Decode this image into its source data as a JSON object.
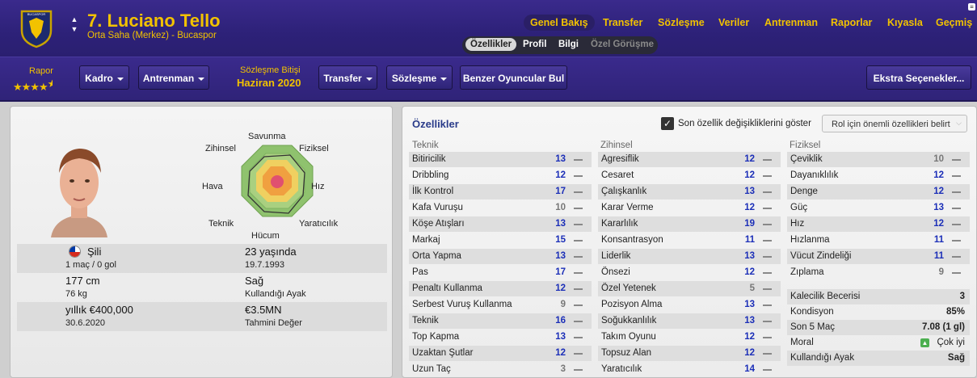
{
  "header": {
    "club_crest_text": "BUCASPOR",
    "player_title": "7. Luciano Tello",
    "player_role": "Orta Saha (Merkez) - Bucaspor",
    "nav": [
      {
        "label": "Genel Bakış",
        "active": true
      },
      {
        "label": "Transfer"
      },
      {
        "label": "Sözleşme"
      },
      {
        "label": "Veriler"
      },
      {
        "label": "Antrenman"
      },
      {
        "label": "Raporlar"
      },
      {
        "label": "Kıyasla"
      },
      {
        "label": "Geçmiş"
      }
    ],
    "subtabs": [
      {
        "label": "Özellikler",
        "selected": true
      },
      {
        "label": "Profil"
      },
      {
        "label": "Bilgi"
      },
      {
        "label": "Özel Görüşme",
        "disabled": true
      }
    ]
  },
  "toolbar": {
    "report_label": "Rapor",
    "report_stars": 4.5,
    "kadro": "Kadro",
    "antrenman": "Antrenman",
    "contract_end_label": "Sözleşme Bitişi",
    "contract_end_value": "Haziran 2020",
    "transfer": "Transfer",
    "sozlesme": "Sözleşme",
    "similar": "Benzer Oyuncular Bul",
    "extra": "Ekstra Seçenekler..."
  },
  "radar": {
    "labels": {
      "top": "Savunma",
      "top_right": "Fiziksel",
      "right": "Hız",
      "bottom_right": "Yaratıcılık",
      "bottom": "Hücum",
      "bottom_left": "Teknik",
      "left": "Hava",
      "top_left": "Zihinsel"
    }
  },
  "player_info": {
    "nation": "Şili",
    "caps": "1 maç / 0 gol",
    "age": "23 yaşında",
    "dob": "19.7.1993",
    "height": "177 cm",
    "weight": "76 kg",
    "foot": "Sağ",
    "foot_label": "Kullandığı Ayak",
    "wage": "yıllık €400,000",
    "wage_until": "30.6.2020",
    "value": "€3.5MN",
    "value_label": "Tahmini Değer"
  },
  "attributes": {
    "title": "Özellikler",
    "show_changes_label": "Son özellik değişikliklerini göster",
    "show_changes_checked": true,
    "role_button": "Rol için önemli özellikleri belirt",
    "technical_header": "Teknik",
    "technical": [
      {
        "name": "Bitiricilik",
        "value": "13",
        "color": "blue"
      },
      {
        "name": "Dribbling",
        "value": "12",
        "color": "blue"
      },
      {
        "name": "İlk Kontrol",
        "value": "17",
        "color": "blue"
      },
      {
        "name": "Kafa Vuruşu",
        "value": "10",
        "color": "gray"
      },
      {
        "name": "Köşe Atışları",
        "value": "13",
        "color": "blue"
      },
      {
        "name": "Markaj",
        "value": "15",
        "color": "blue"
      },
      {
        "name": "Orta Yapma",
        "value": "13",
        "color": "blue"
      },
      {
        "name": "Pas",
        "value": "17",
        "color": "blue"
      },
      {
        "name": "Penaltı Kullanma",
        "value": "12",
        "color": "blue"
      },
      {
        "name": "Serbest Vuruş Kullanma",
        "value": "9",
        "color": "gray"
      },
      {
        "name": "Teknik",
        "value": "16",
        "color": "blue"
      },
      {
        "name": "Top Kapma",
        "value": "13",
        "color": "blue"
      },
      {
        "name": "Uzaktan Şutlar",
        "value": "12",
        "color": "blue"
      },
      {
        "name": "Uzun Taç",
        "value": "3",
        "color": "gray"
      }
    ],
    "mental_header": "Zihinsel",
    "mental": [
      {
        "name": "Agresiflik",
        "value": "12",
        "color": "blue"
      },
      {
        "name": "Cesaret",
        "value": "12",
        "color": "blue"
      },
      {
        "name": "Çalışkanlık",
        "value": "13",
        "color": "blue"
      },
      {
        "name": "Karar Verme",
        "value": "12",
        "color": "blue"
      },
      {
        "name": "Kararlılık",
        "value": "19",
        "color": "blue"
      },
      {
        "name": "Konsantrasyon",
        "value": "11",
        "color": "blue"
      },
      {
        "name": "Liderlik",
        "value": "13",
        "color": "blue"
      },
      {
        "name": "Önsezi",
        "value": "12",
        "color": "blue"
      },
      {
        "name": "Özel Yetenek",
        "value": "5",
        "color": "gray"
      },
      {
        "name": "Pozisyon Alma",
        "value": "13",
        "color": "blue"
      },
      {
        "name": "Soğukkanlılık",
        "value": "13",
        "color": "blue"
      },
      {
        "name": "Takım Oyunu",
        "value": "12",
        "color": "blue"
      },
      {
        "name": "Topsuz Alan",
        "value": "12",
        "color": "blue"
      },
      {
        "name": "Yaratıcılık",
        "value": "14",
        "color": "blue"
      }
    ],
    "physical_header": "Fiziksel",
    "physical": [
      {
        "name": "Çeviklik",
        "value": "10",
        "color": "gray"
      },
      {
        "name": "Dayanıklılık",
        "value": "12",
        "color": "blue"
      },
      {
        "name": "Denge",
        "value": "12",
        "color": "blue"
      },
      {
        "name": "Güç",
        "value": "13",
        "color": "blue"
      },
      {
        "name": "Hız",
        "value": "12",
        "color": "blue"
      },
      {
        "name": "Hızlanma",
        "value": "11",
        "color": "blue"
      },
      {
        "name": "Vücut Zindeliği",
        "value": "11",
        "color": "blue"
      },
      {
        "name": "Zıplama",
        "value": "9",
        "color": "gray"
      }
    ],
    "extra": [
      {
        "name": "Kalecilik Becerisi",
        "value": "3"
      },
      {
        "name": "Kondisyon",
        "value": "85%"
      },
      {
        "name": "Son 5 Maç",
        "value": "7.08 (1 gl)"
      },
      {
        "name": "Moral",
        "value": "Çok iyi"
      },
      {
        "name": "Kullandığı Ayak",
        "value": "Sağ"
      }
    ]
  },
  "colors": {
    "accent": "#f2c200",
    "header_bg": "#2d2178",
    "blue_value": "#1c2fb8"
  }
}
